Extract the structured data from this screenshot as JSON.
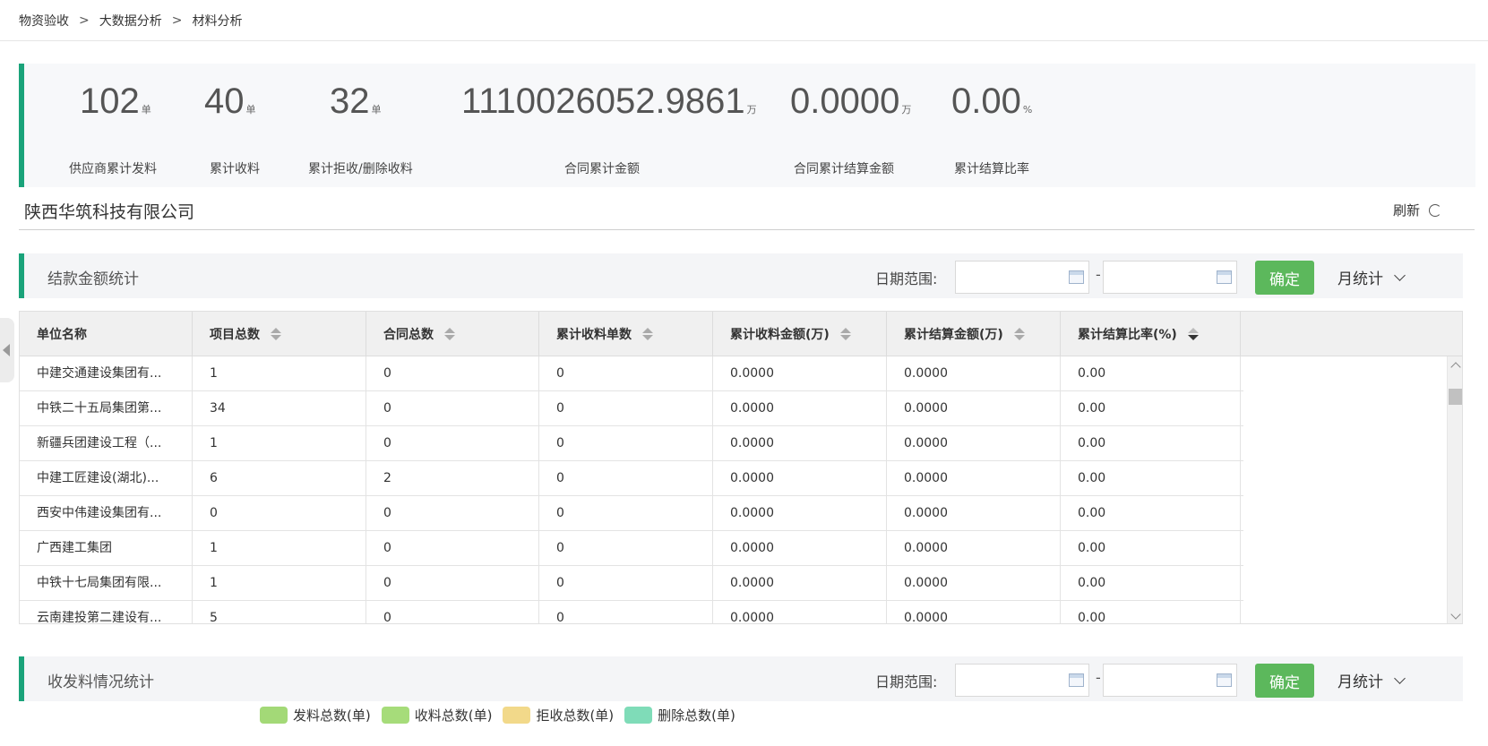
{
  "breadcrumb": {
    "items": [
      "物资验收",
      "大数据分析",
      "材料分析"
    ],
    "separator": ">"
  },
  "stats": [
    {
      "value": "102",
      "unit": "单",
      "label": "供应商累计发料"
    },
    {
      "value": "40",
      "unit": "单",
      "label": "累计收料"
    },
    {
      "value": "32",
      "unit": "单",
      "label": "累计拒收/删除收料"
    },
    {
      "value": "1110026052.9861",
      "unit": "万",
      "label": "合同累计金额"
    },
    {
      "value": "0.0000",
      "unit": "万",
      "label": "合同累计结算金额"
    },
    {
      "value": "0.00",
      "unit": "%",
      "label": "累计结算比率"
    }
  ],
  "company": {
    "name": "陕西华筑科技有限公司",
    "refresh_label": "刷新",
    "refresh_icon": "refresh-icon"
  },
  "settlement_section": {
    "title": "结款金额统计",
    "date_label": "日期范围:",
    "date_separator": "-",
    "start_date": "",
    "end_date": "",
    "confirm_label": "确定",
    "mode": "月统计"
  },
  "table": {
    "columns": [
      "单位名称",
      "项目总数",
      "合同总数",
      "累计收料单数",
      "累计收料金额(万)",
      "累计结算金额(万)",
      "累计结算比率(%)"
    ],
    "rows": [
      [
        "中建交通建设集团有...",
        "1",
        "0",
        "0",
        "0.0000",
        "0.0000",
        "0.00"
      ],
      [
        "中铁二十五局集团第...",
        "34",
        "0",
        "0",
        "0.0000",
        "0.0000",
        "0.00"
      ],
      [
        "新疆兵团建设工程（...",
        "1",
        "0",
        "0",
        "0.0000",
        "0.0000",
        "0.00"
      ],
      [
        "中建工匠建设(湖北)...",
        "6",
        "2",
        "0",
        "0.0000",
        "0.0000",
        "0.00"
      ],
      [
        "西安中伟建设集团有...",
        "0",
        "0",
        "0",
        "0.0000",
        "0.0000",
        "0.00"
      ],
      [
        "广西建工集团",
        "1",
        "0",
        "0",
        "0.0000",
        "0.0000",
        "0.00"
      ],
      [
        "中铁十七局集团有限...",
        "1",
        "0",
        "0",
        "0.0000",
        "0.0000",
        "0.00"
      ],
      [
        "云南建投第二建设有...",
        "5",
        "0",
        "0",
        "0.0000",
        "0.0000",
        "0.00"
      ]
    ]
  },
  "material_section": {
    "title": "收发料情况统计",
    "date_label": "日期范围:",
    "date_separator": "-",
    "start_date": "",
    "end_date": "",
    "confirm_label": "确定",
    "mode": "月统计"
  },
  "legend": [
    {
      "label": "发料总数(单)",
      "color": "#a3d977"
    },
    {
      "label": "收料总数(单)",
      "color": "#a6dc7a"
    },
    {
      "label": "拒收总数(单)",
      "color": "#f2d98a"
    },
    {
      "label": "删除总数(单)",
      "color": "#7fdcb8"
    }
  ],
  "colors": {
    "accent": "#1aa37a",
    "confirm_button": "#5cb85c"
  }
}
